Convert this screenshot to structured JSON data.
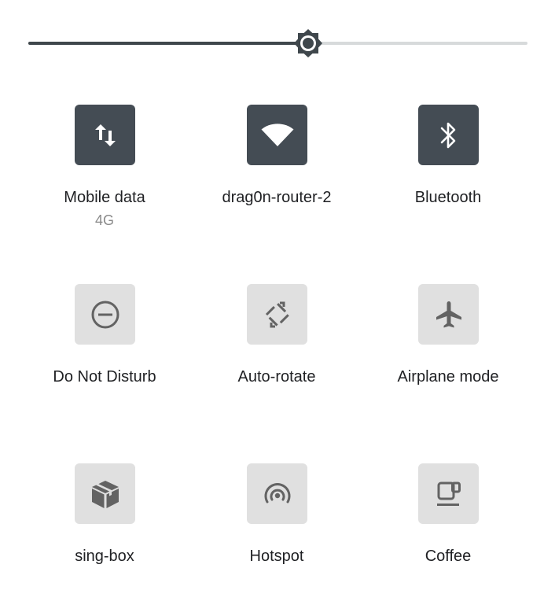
{
  "brightness": {
    "level": 0.56
  },
  "colors": {
    "tile_on": "#444c54",
    "tile_off": "#e0e0e0",
    "icon_on": "#ffffff",
    "icon_off": "#636363",
    "slider_fill": "#3f474c",
    "slider_track": "#d7dadb"
  },
  "tiles": [
    {
      "id": "mobile-data",
      "label": "Mobile data",
      "sub": "4G",
      "icon": "mobile-data-icon",
      "state": "on"
    },
    {
      "id": "wifi",
      "label": "drag0n-router-2",
      "sub": "",
      "icon": "wifi-icon",
      "state": "on"
    },
    {
      "id": "bluetooth",
      "label": "Bluetooth",
      "sub": "",
      "icon": "bluetooth-icon",
      "state": "on"
    },
    {
      "id": "do-not-disturb",
      "label": "Do Not Disturb",
      "sub": "",
      "icon": "do-not-disturb-icon",
      "state": "off"
    },
    {
      "id": "auto-rotate",
      "label": "Auto-rotate",
      "sub": "",
      "icon": "auto-rotate-icon",
      "state": "off"
    },
    {
      "id": "airplane-mode",
      "label": "Airplane mode",
      "sub": "",
      "icon": "airplane-icon",
      "state": "off"
    },
    {
      "id": "sing-box",
      "label": "sing-box",
      "sub": "",
      "icon": "package-icon",
      "state": "off"
    },
    {
      "id": "hotspot",
      "label": "Hotspot",
      "sub": "",
      "icon": "hotspot-icon",
      "state": "off"
    },
    {
      "id": "coffee",
      "label": "Coffee",
      "sub": "",
      "icon": "coffee-icon",
      "state": "off"
    }
  ]
}
